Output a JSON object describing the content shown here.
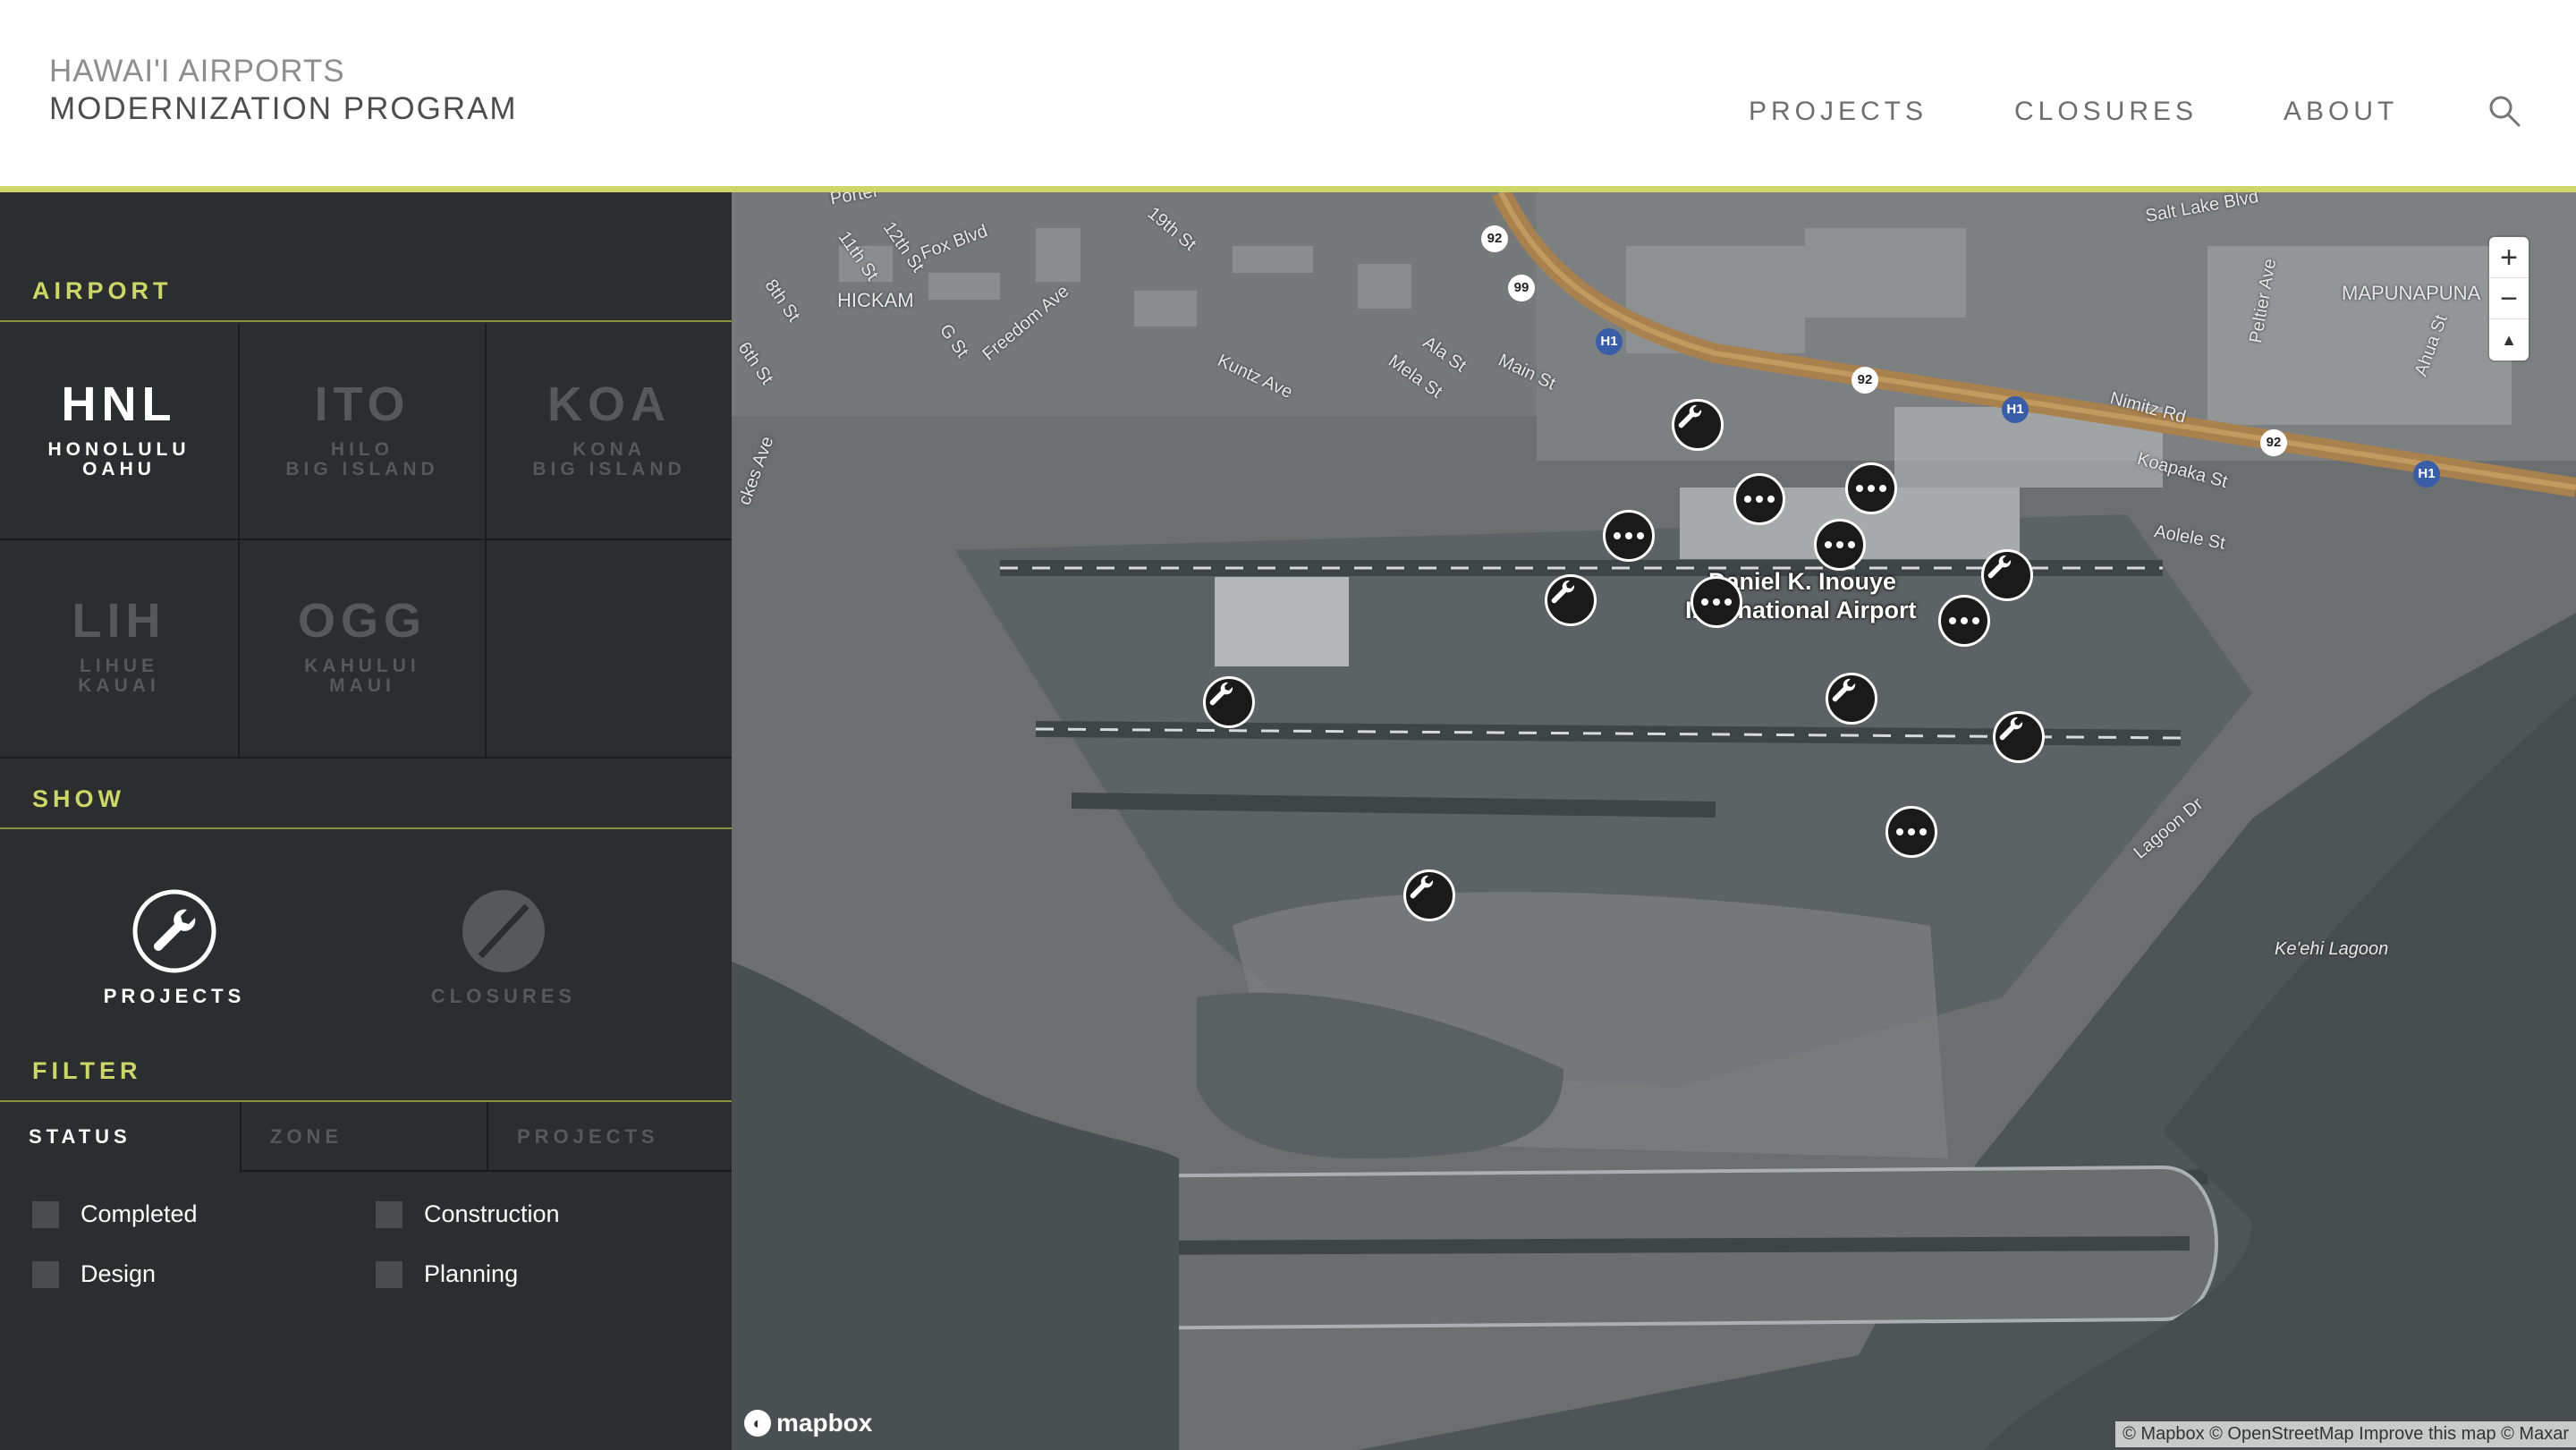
{
  "header": {
    "title_line1": "HAWAI'I AIRPORTS",
    "title_line2": "MODERNIZATION PROGRAM",
    "nav": [
      {
        "label": "PROJECTS"
      },
      {
        "label": "CLOSURES"
      },
      {
        "label": "ABOUT"
      }
    ],
    "search_icon": "search-icon"
  },
  "colors": {
    "accent": "#cdd668",
    "sidebar_bg": "#2b2d2f",
    "active_text": "#ffffff",
    "dim_text": "#56585a"
  },
  "sidebar": {
    "airport_label": "AIRPORT",
    "airports": [
      {
        "code": "HNL",
        "name1": "HONOLULU",
        "name2": "OAHU",
        "active": true
      },
      {
        "code": "ITO",
        "name1": "HILO",
        "name2": "BIG ISLAND",
        "active": false
      },
      {
        "code": "KOA",
        "name1": "KONA",
        "name2": "BIG ISLAND",
        "active": false
      },
      {
        "code": "LIH",
        "name1": "LIHUE",
        "name2": "KAUAI",
        "active": false
      },
      {
        "code": "OGG",
        "name1": "KAHULUI",
        "name2": "MAUI",
        "active": false
      }
    ],
    "show_label": "SHOW",
    "show": {
      "projects_label": "PROJECTS",
      "projects_icon": "wrench-icon",
      "closures_label": "CLOSURES",
      "closures_icon": "slash-circle-icon"
    },
    "filter_label": "FILTER",
    "tabs": [
      {
        "label": "STATUS",
        "active": true
      },
      {
        "label": "ZONE",
        "active": false
      },
      {
        "label": "PROJECTS",
        "active": false
      }
    ],
    "checkboxes": [
      {
        "label": "Completed",
        "checked": false
      },
      {
        "label": "Construction",
        "checked": false
      },
      {
        "label": "Design",
        "checked": false
      },
      {
        "label": "Planning",
        "checked": false
      }
    ]
  },
  "map": {
    "labels": {
      "hickam": "HICKAM",
      "mapunapuna": "MAPUNAPUNA",
      "fox_blvd": "Fox Blvd",
      "kuntz_ave": "Kuntz Ave",
      "salt_lake_blvd": "Salt Lake Blvd",
      "nimitz_rd": "Nimitz Rd",
      "koapaka_st": "Koapaka St",
      "aolele_st": "Aolele St",
      "lagoon_dr": "Lagoon Dr",
      "keehi_lagoon": "Ke'ehi Lagoon",
      "freedom_ave": "Freedom Ave",
      "main_st": "Main St",
      "porter": "Porter",
      "12th_st": "12th St",
      "11th_st": "11th St",
      "19th_st": "19th St",
      "8th_st": "8th St",
      "6th_st": "6th St",
      "g_st": "G St",
      "ala_st": "Ala St",
      "mela_st": "Mela St",
      "peltier_ave": "Peltier Ave",
      "ahua_st": "Ahua St",
      "hickam_ave": "ckes Ave"
    },
    "airport_label_line1": "Daniel K. Inouye",
    "airport_label_line2": "International Airport",
    "shields": [
      "92",
      "99",
      "H1",
      "92",
      "H1",
      "92",
      "H1"
    ],
    "zoom_in": "+",
    "zoom_out": "−",
    "compass": "▲",
    "logo_text": "mapbox",
    "attribution": "© Mapbox © OpenStreetMap Improve this map © Maxar",
    "markers": [
      {
        "type": "project",
        "icon": "wrench-icon"
      },
      {
        "type": "closure",
        "icon": "more-icon"
      },
      {
        "type": "closure",
        "icon": "more-icon"
      },
      {
        "type": "closure",
        "icon": "more-icon"
      },
      {
        "type": "closure",
        "icon": "more-icon"
      },
      {
        "type": "project",
        "icon": "wrench-icon"
      },
      {
        "type": "closure",
        "icon": "more-icon"
      },
      {
        "type": "project",
        "icon": "wrench-icon"
      },
      {
        "type": "closure",
        "icon": "more-icon"
      },
      {
        "type": "project",
        "icon": "wrench-icon"
      },
      {
        "type": "project",
        "icon": "wrench-icon"
      },
      {
        "type": "project",
        "icon": "wrench-icon"
      },
      {
        "type": "closure",
        "icon": "more-icon"
      },
      {
        "type": "project",
        "icon": "wrench-icon"
      }
    ]
  }
}
